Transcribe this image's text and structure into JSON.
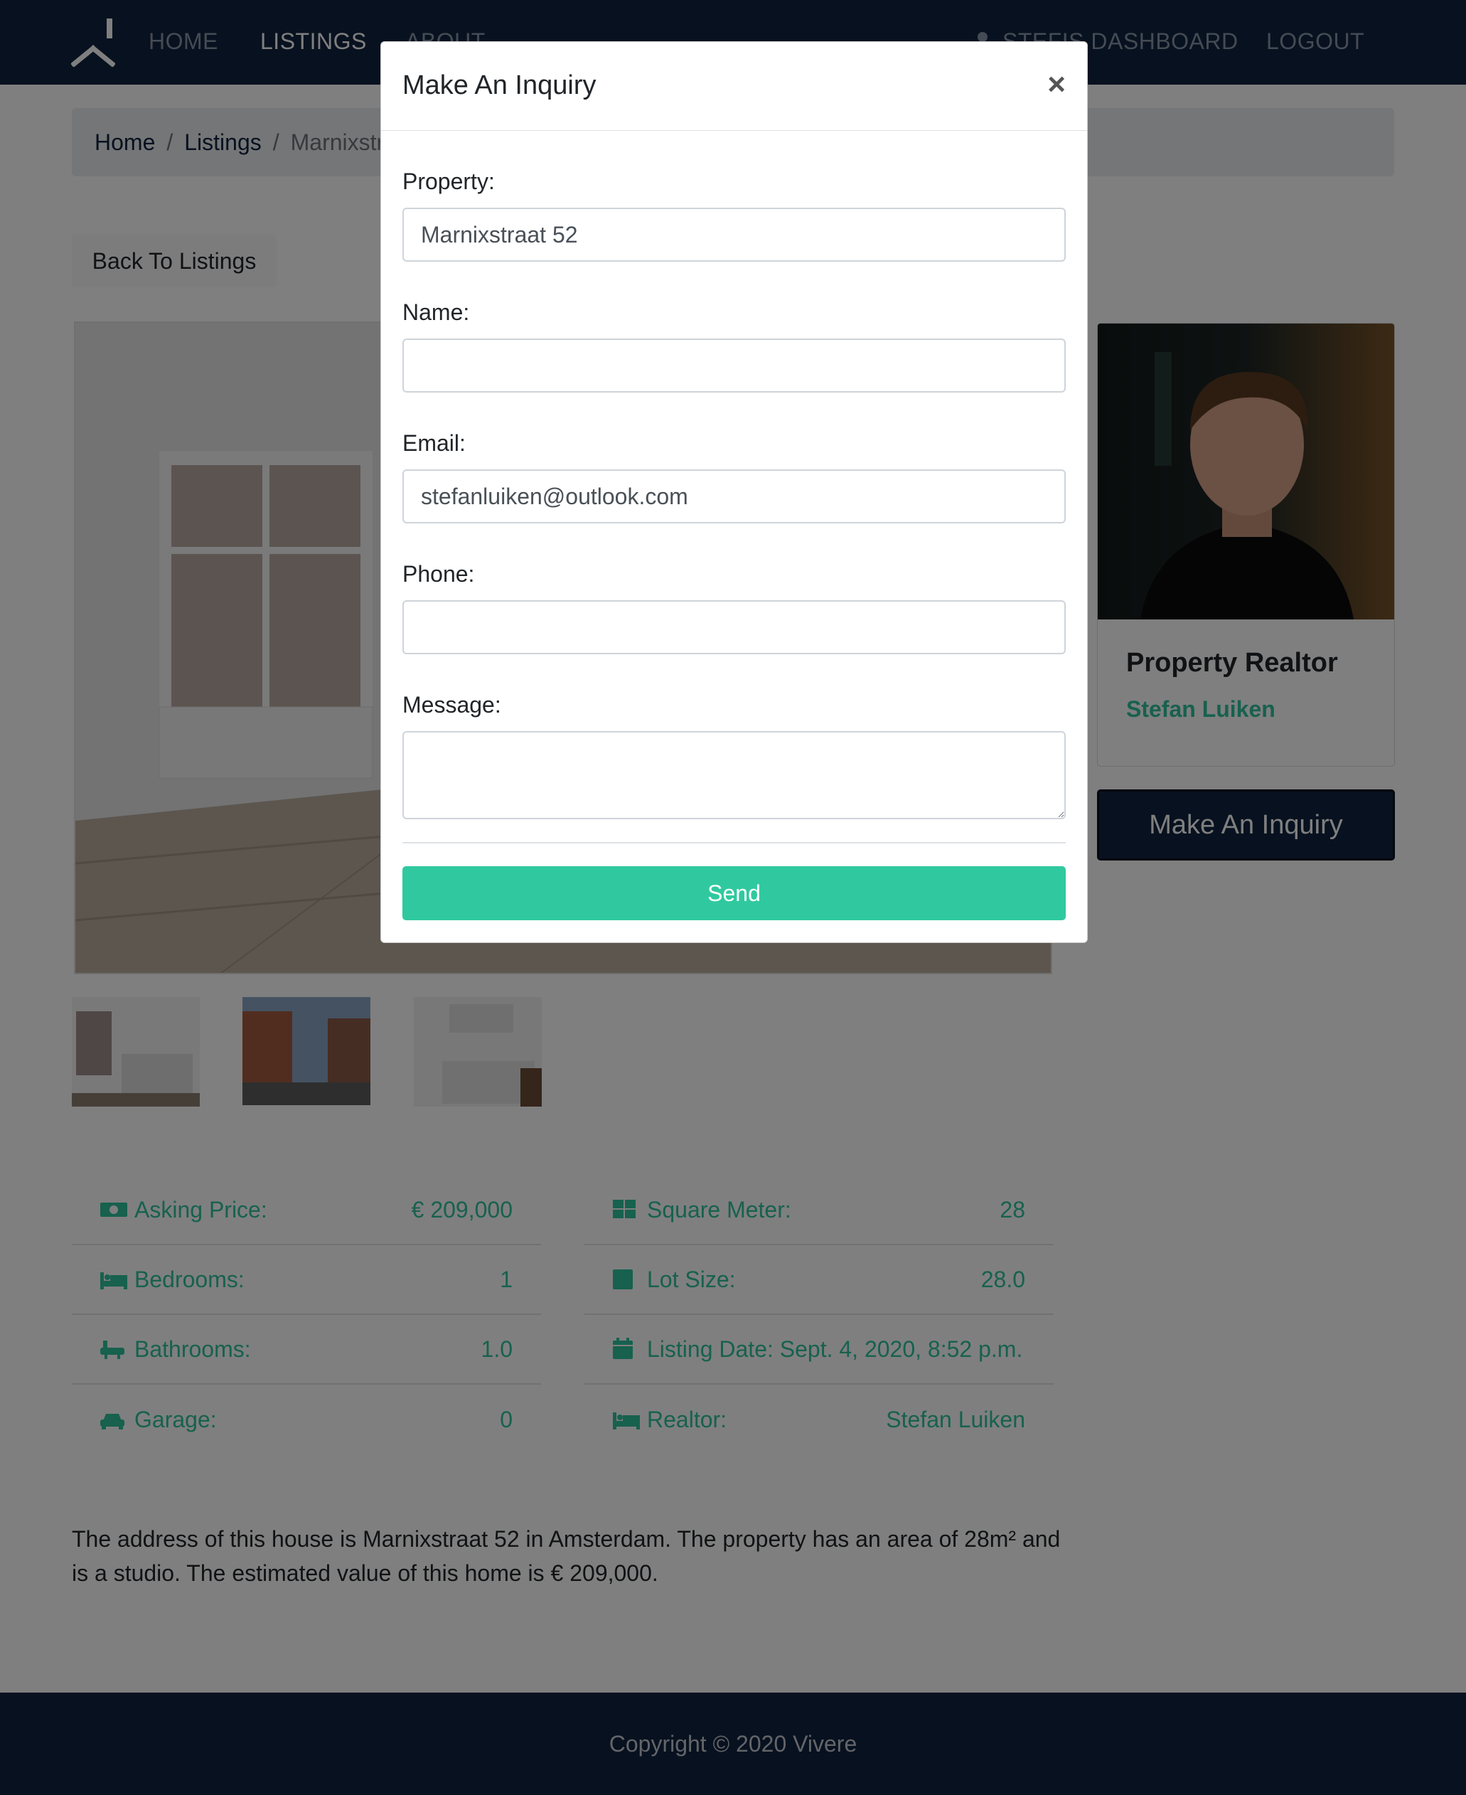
{
  "nav": {
    "links": [
      "HOME",
      "LISTINGS",
      "ABOUT"
    ],
    "dashboard": "STEFIS DASHBOARD",
    "logout": "LOGOUT"
  },
  "breadcrumb": {
    "home": "Home",
    "listings": "Listings",
    "current": "Marnixstraat 52",
    "separator": "/"
  },
  "back_button": "Back To Listings",
  "realtor_card": {
    "title": "Property Realtor",
    "name": "Stefan Luiken"
  },
  "inquiry_button": "Make An Inquiry",
  "details_left": [
    {
      "icon": "money-icon",
      "label": "Asking Price:",
      "value": "€ 209,000"
    },
    {
      "icon": "bed-icon",
      "label": "Bedrooms:",
      "value": "1"
    },
    {
      "icon": "bath-icon",
      "label": "Bathrooms:",
      "value": "1.0"
    },
    {
      "icon": "car-icon",
      "label": "Garage:",
      "value": "0"
    }
  ],
  "details_right": [
    {
      "icon": "grid-icon",
      "label": "Square Meter:",
      "value": "28"
    },
    {
      "icon": "square-icon",
      "label": "Lot Size:",
      "value": "28.0"
    },
    {
      "icon": "calendar-icon",
      "label": "Listing Date: Sept. 4, 2020, 8:52 p.m.",
      "value": ""
    },
    {
      "icon": "bed-icon",
      "label": "Realtor:",
      "value": "Stefan Luiken"
    }
  ],
  "description": "The address of this house is Marnixstraat 52 in Amsterdam. The property has an area of 28m² and is a studio. The estimated value of this home is € 209,000.",
  "footer": "Copyright © 2020 Vivere",
  "modal": {
    "title": "Make An Inquiry",
    "close": "×",
    "property_label": "Property:",
    "property_value": "Marnixstraat 52",
    "name_label": "Name:",
    "name_value": "",
    "email_label": "Email:",
    "email_value": "stefanluiken@outlook.com",
    "phone_label": "Phone:",
    "phone_value": "",
    "message_label": "Message:",
    "message_value": "",
    "send": "Send"
  },
  "colors": {
    "navy": "#10223e",
    "accent_green": "#2fc39d",
    "send_green": "#30c99f"
  }
}
